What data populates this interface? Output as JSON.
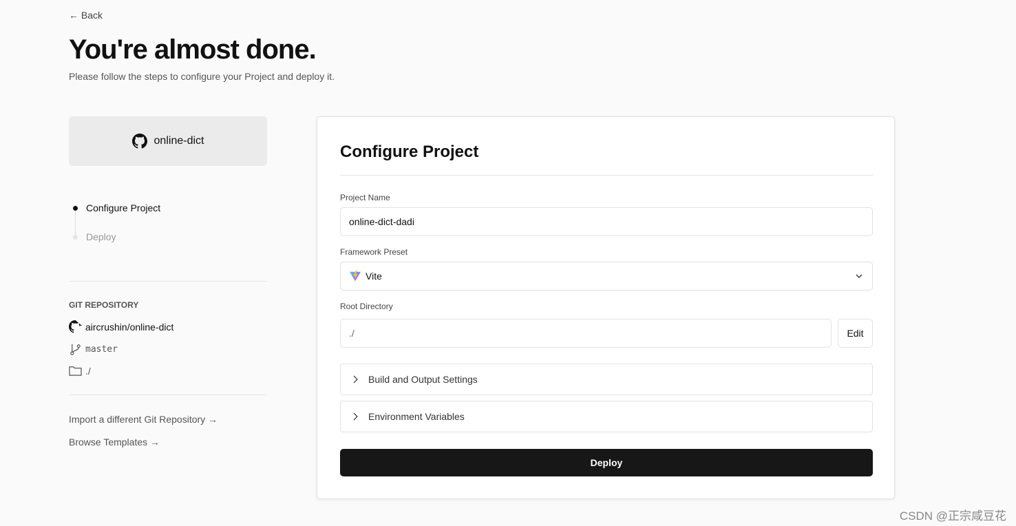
{
  "back_label": "← Back",
  "title": "You're almost done.",
  "subtitle": "Please follow the steps to configure your Project and deploy it.",
  "repo_card": {
    "name": "online-dict",
    "icon": "github-icon"
  },
  "steps": [
    {
      "label": "Configure Project",
      "active": true
    },
    {
      "label": "Deploy",
      "active": false
    }
  ],
  "git": {
    "heading": "GIT REPOSITORY",
    "repo": "aircrushin/online-dict",
    "branch": "master",
    "directory": "./"
  },
  "links": {
    "import": "Import a different Git Repository →",
    "templates": "Browse Templates →"
  },
  "panel": {
    "title": "Configure Project",
    "project_name_label": "Project Name",
    "project_name_value": "online-dict-dadi",
    "framework_label": "Framework Preset",
    "framework_value": "Vite",
    "root_label": "Root Directory",
    "root_value": "./",
    "edit_label": "Edit",
    "accordions": [
      "Build and Output Settings",
      "Environment Variables"
    ],
    "deploy_label": "Deploy"
  },
  "watermark": "CSDN @正宗咸豆花"
}
